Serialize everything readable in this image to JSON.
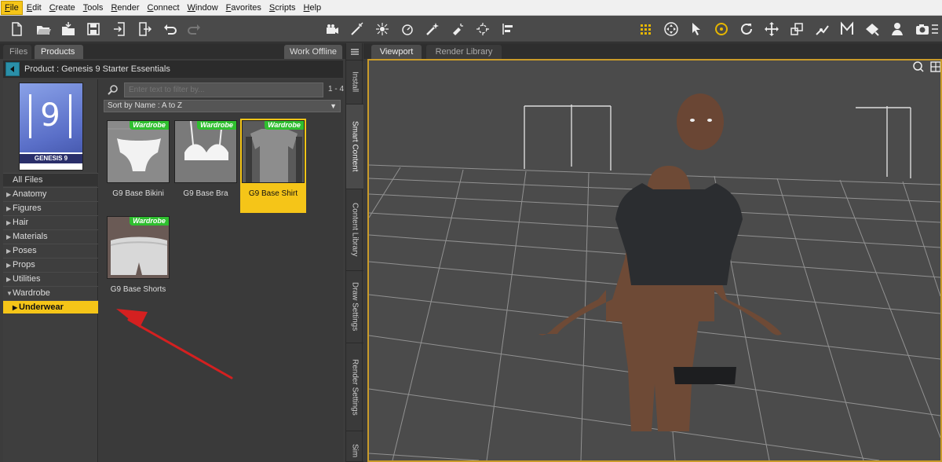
{
  "menu": [
    "File",
    "Edit",
    "Create",
    "Tools",
    "Render",
    "Connect",
    "Window",
    "Favorites",
    "Scripts",
    "Help"
  ],
  "left_tabs": {
    "files": "Files",
    "products": "Products",
    "work_offline": "Work Offline"
  },
  "product_bar": {
    "title": "Product :  Genesis 9 Starter Essentials"
  },
  "thumbnail": {
    "number": "9",
    "label": "GENESIS 9"
  },
  "categories": {
    "all": "All Files",
    "items": [
      "Anatomy",
      "Figures",
      "Hair",
      "Materials",
      "Poses",
      "Props",
      "Utilities",
      "Wardrobe"
    ],
    "sub_selected": "Underwear"
  },
  "filter": {
    "placeholder": "Enter text to filter by...",
    "count": "1 - 4"
  },
  "sort": {
    "label": "Sort by Name : A to Z"
  },
  "assets": [
    {
      "badge": "Wardrobe",
      "name": "G9 Base Bikini"
    },
    {
      "badge": "Wardrobe",
      "name": "G9 Base Bra"
    },
    {
      "badge": "Wardrobe",
      "name": "G9 Base Shirt"
    },
    {
      "badge": "Wardrobe",
      "name": "G9 Base Shorts"
    }
  ],
  "side_tabs": [
    "Install",
    "Smart Content",
    "Content Library",
    "Draw Settings",
    "Render Settings",
    "Sim"
  ],
  "viewport_tabs": {
    "viewport": "Viewport",
    "render_library": "Render Library"
  },
  "colors": {
    "accent": "#f5c518",
    "badge": "#2fbf2f",
    "viewport_border": "#c99b2a",
    "back_button": "#2a8fa8",
    "arrow": "#d42020"
  }
}
